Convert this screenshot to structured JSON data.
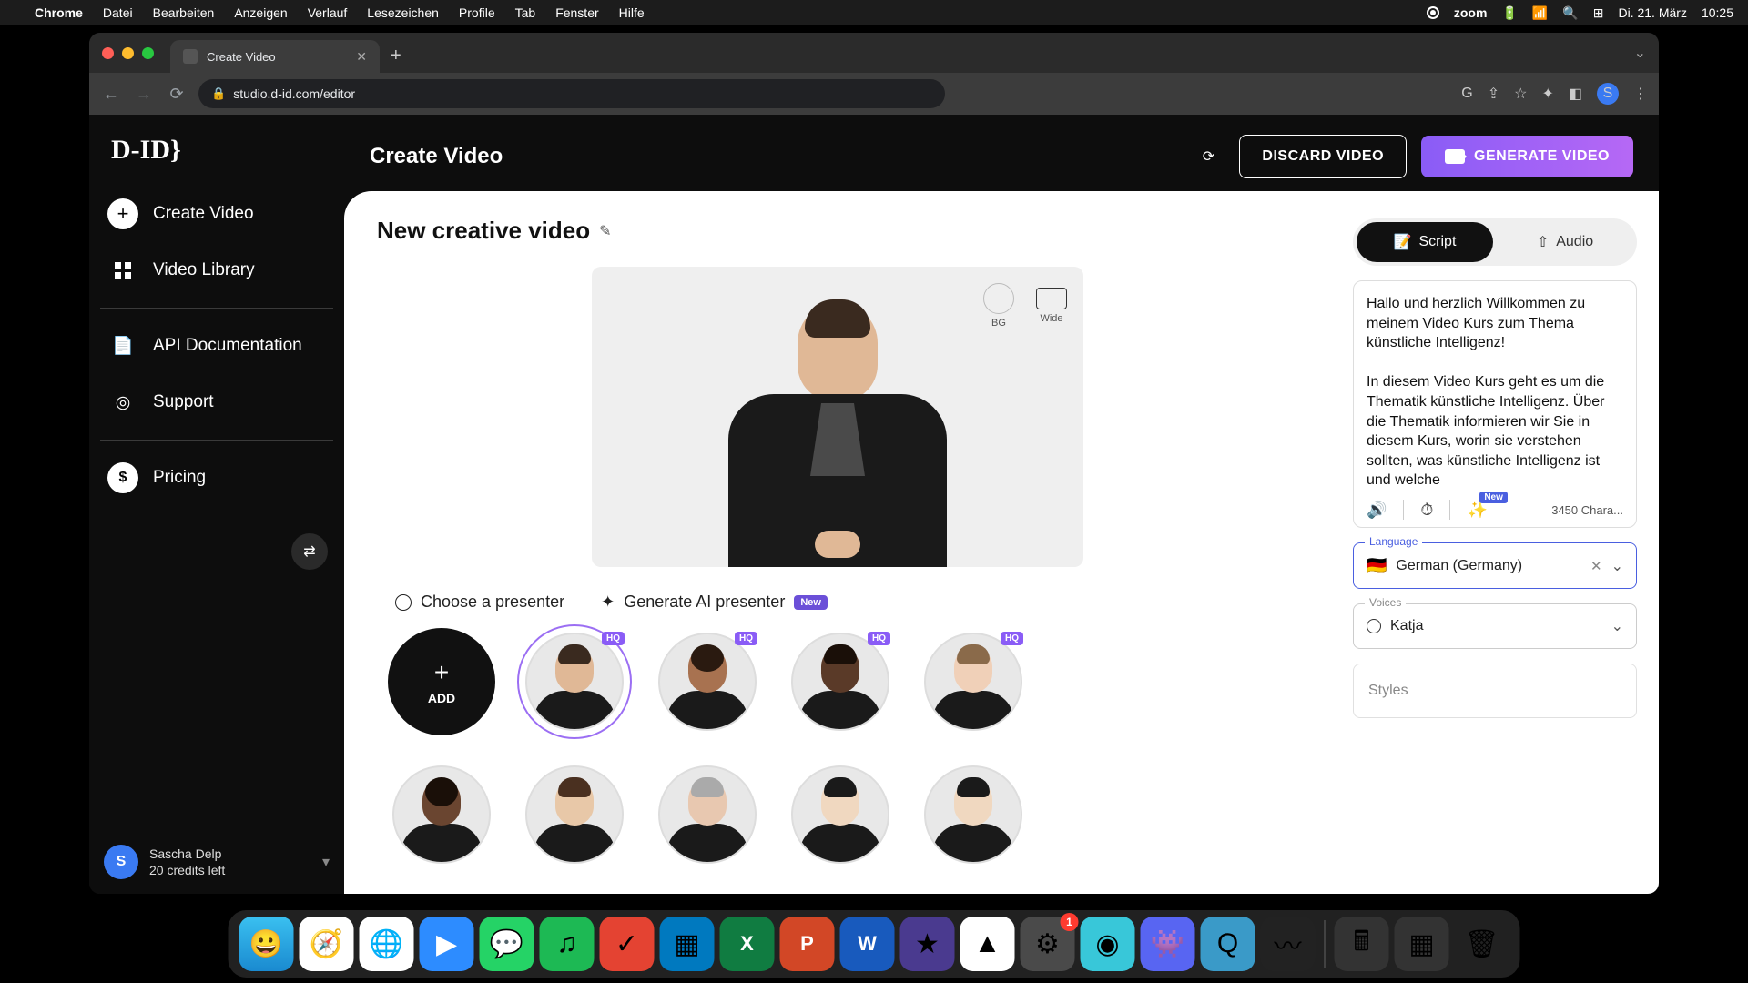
{
  "menubar": {
    "app": "Chrome",
    "items": [
      "Datei",
      "Bearbeiten",
      "Anzeigen",
      "Verlauf",
      "Lesezeichen",
      "Profile",
      "Tab",
      "Fenster",
      "Hilfe"
    ],
    "right": {
      "zoom": "zoom",
      "date": "Di. 21. März",
      "time": "10:25"
    }
  },
  "browser": {
    "tab_title": "Create Video",
    "url": "studio.d-id.com/editor",
    "profile_initial": "S"
  },
  "sidebar": {
    "logo": "D-ID}",
    "items": [
      {
        "label": "Create Video"
      },
      {
        "label": "Video Library"
      },
      {
        "label": "API Documentation"
      },
      {
        "label": "Support"
      },
      {
        "label": "Pricing"
      }
    ],
    "user": {
      "initial": "S",
      "name": "Sascha Delp",
      "credits": "20 credits left"
    }
  },
  "header": {
    "title": "Create Video",
    "discard": "DISCARD VIDEO",
    "generate": "GENERATE VIDEO"
  },
  "canvas": {
    "video_title": "New creative video",
    "controls": {
      "bg": "BG",
      "wide": "Wide"
    },
    "tab_choose": "Choose a presenter",
    "tab_generate": "Generate AI presenter",
    "tab_generate_badge": "New",
    "add_label": "ADD",
    "hq": "HQ"
  },
  "script_panel": {
    "tab_script": "Script",
    "tab_audio": "Audio",
    "text": "Hallo und herzlich Willkommen zu meinem Video Kurs zum Thema künstliche Intelligenz!\n\nIn diesem Video Kurs geht es um die Thematik künstliche Intelligenz. Über die Thematik informieren wir Sie in diesem Kurs, worin sie verstehen sollten, was künstliche Intelligenz ist und welche",
    "new_badge": "New",
    "char_count": "3450 Chara...",
    "language_label": "Language",
    "language_value": "German (Germany)",
    "language_flag": "🇩🇪",
    "voices_label": "Voices",
    "voices_value": "Katja",
    "styles_label": "Styles"
  },
  "dock": {
    "settings_badge": "1"
  }
}
